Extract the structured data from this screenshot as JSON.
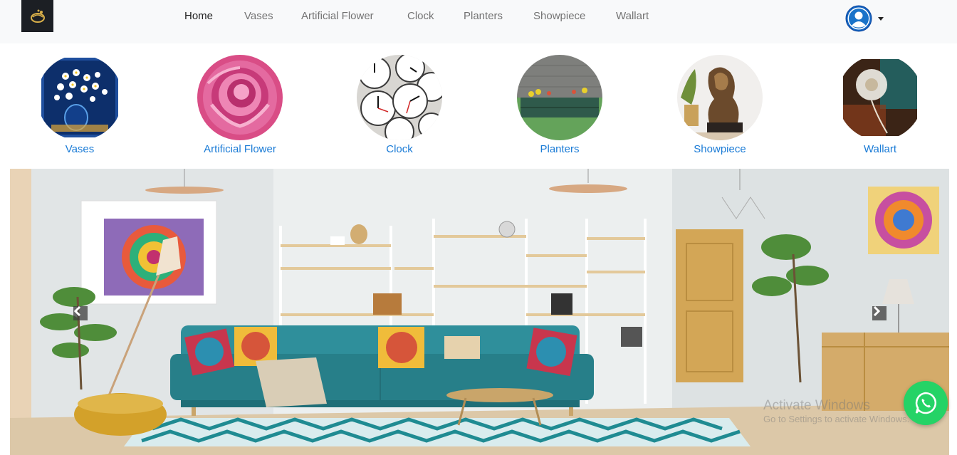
{
  "nav": {
    "links": [
      "Home",
      "Vases",
      "Artificial Flower",
      "Clock",
      "Planters",
      "Showpiece",
      "Wallart"
    ],
    "active": "Home"
  },
  "categories": [
    {
      "label": "Vases",
      "icon": "vase-flowers-image"
    },
    {
      "label": "Artificial Flower",
      "icon": "peony-flower-image"
    },
    {
      "label": "Clock",
      "icon": "clocks-image"
    },
    {
      "label": "Planters",
      "icon": "planter-bed-image"
    },
    {
      "label": "Showpiece",
      "icon": "lion-statue-image"
    },
    {
      "label": "Wallart",
      "icon": "dandelion-painting-image"
    }
  ],
  "carousel": {
    "slide": "living-room-interior",
    "prev_icon": "chevron-left-icon",
    "next_icon": "chevron-right-icon"
  },
  "watermark": {
    "line1": "Activate Windows",
    "line2": "Go to Settings to activate Windows."
  },
  "colors": {
    "link": "#1a7bd6",
    "navbar_bg": "#f8f9fa",
    "whatsapp": "#25d366",
    "sofa": "#2f8f9b"
  }
}
